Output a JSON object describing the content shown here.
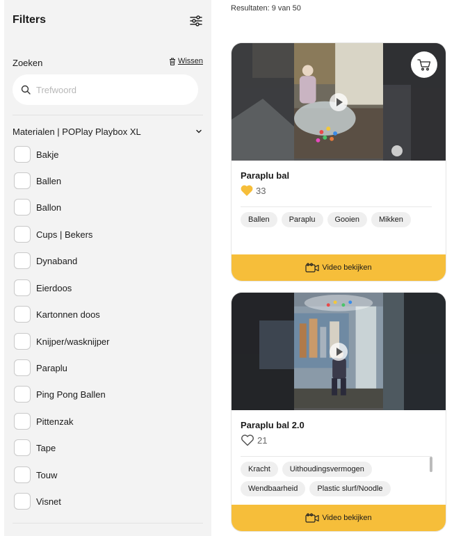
{
  "sidebar": {
    "title": "Filters",
    "search_label": "Zoeken",
    "clear_label": "Wissen",
    "search_placeholder": "Trefwoord",
    "section_title": "Materialen | POPlay Playbox XL",
    "options": [
      "Bakje",
      "Ballen",
      "Ballon",
      "Cups | Bekers",
      "Dynaband",
      "Eierdoos",
      "Kartonnen doos",
      "Knijper/wasknijper",
      "Paraplu",
      "Ping Pong Ballen",
      "Pittenzak",
      "Tape",
      "Touw",
      "Visnet"
    ]
  },
  "results": {
    "count_text": "Resultaten: 9 van 50",
    "cards": [
      {
        "title": "Paraplu bal",
        "likes": "33",
        "liked": true,
        "tags": [
          "Ballen",
          "Paraplu",
          "Gooien",
          "Mikken"
        ],
        "video_label": "Video bekijken"
      },
      {
        "title": "Paraplu bal 2.0",
        "likes": "21",
        "liked": false,
        "tags": [
          "Kracht",
          "Uithoudingsvermogen",
          "Wendbaarheid",
          "Plastic slurf/Noodle"
        ],
        "video_label": "Video bekijken"
      }
    ]
  },
  "colors": {
    "accent": "#f6be3a",
    "heart": "#f6be3a",
    "sidebar_bg": "#f3f3f3"
  }
}
